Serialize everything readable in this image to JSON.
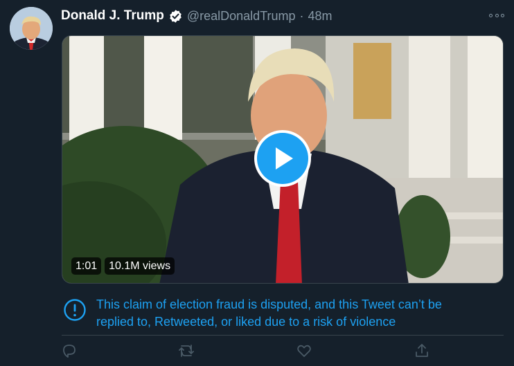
{
  "tweet": {
    "author_name": "Donald J. Trump",
    "handle": "@realDonaldTrump",
    "separator": "·",
    "time": "48m",
    "verified_icon": "verified-badge-icon",
    "more_icon": "more-options-icon"
  },
  "video": {
    "duration": "1:01",
    "views": "10.1M views",
    "play_icon": "play-icon"
  },
  "notice": {
    "icon": "info-circle-icon",
    "line1": "This claim of election fraud is disputed, and this Tweet can’t be",
    "line2": "replied to, Retweeted, or liked due to a risk of violence"
  },
  "actions": [
    "reply-icon",
    "retweet-icon",
    "like-icon",
    "share-icon"
  ],
  "colors": {
    "background": "#15202b",
    "accent": "#1da1f2",
    "secondary_text": "#8899a6",
    "border": "#38444d"
  }
}
